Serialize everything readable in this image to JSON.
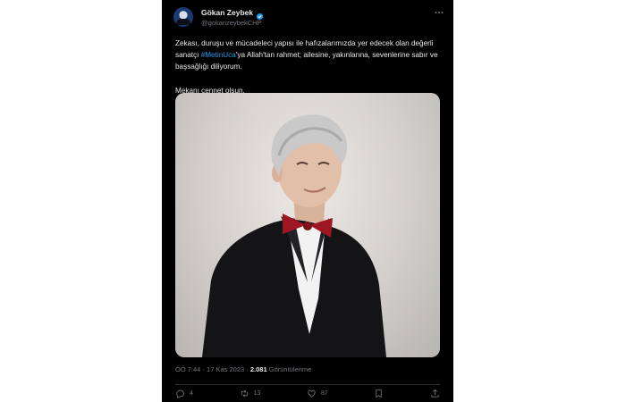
{
  "author": {
    "display_name": "Gökan Zeybek",
    "handle": "@gokanzeybekCHP",
    "avatar_icon": "avatar-photo",
    "verified_icon": "verified-badge-icon",
    "verified_color": "#1d9bf0"
  },
  "tweet": {
    "text_before_hashtag": "Zekası, duruşu ve mücadeleci yapısı ile hafızalarımızda yer edecek olan değerli sanatçı ",
    "hashtag": "#MetinUca",
    "text_after_hashtag": "'ya Allah'tan rahmet; ailesine, yakınlarına, sevenlerine sabır ve başsağlığı diliyorum.",
    "second_paragraph": "Mekanı cennet olsun."
  },
  "meta": {
    "time": "ÖÖ 7:44",
    "separator": "·",
    "date": "17 Kas 2023",
    "views_count": "2.081",
    "views_label": "Görüntülenme"
  },
  "actions": {
    "reply_count": "4",
    "retweet_count": "13",
    "like_count": "87"
  },
  "colors": {
    "background": "#000000",
    "text_primary": "#e7e9ea",
    "text_secondary": "#71767b",
    "accent": "#1d9bf0"
  }
}
